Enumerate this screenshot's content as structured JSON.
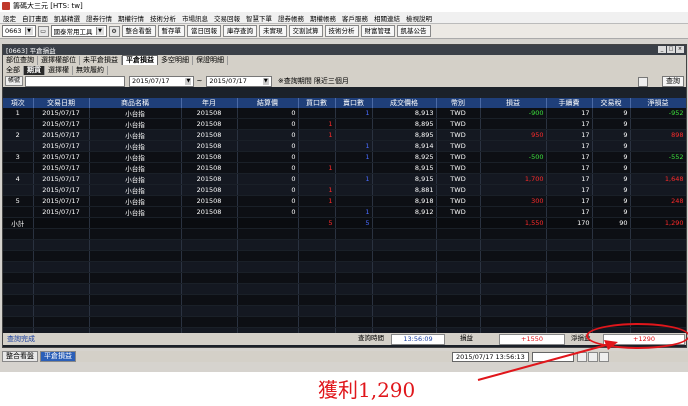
{
  "window_title": "籌碼大三元 [HTS: tw]",
  "menu": [
    "設定",
    "自訂畫面",
    "凱基精選",
    "證券行情",
    "期權行情",
    "技術分析",
    "市場訊息",
    "交易回報",
    "智慧下單",
    "證券帳務",
    "期權帳務",
    "客戶服務",
    "相關連結",
    "檢視說明"
  ],
  "toolbar": {
    "code": "0663",
    "code_dd": "▼",
    "tools_combo": "國泰常用工具",
    "tools_dd": "▼",
    "gear": "⚙",
    "print": "▭",
    "buttons": [
      "整合看盤",
      "暫存單",
      "當日回報",
      "庫存查詢",
      "未實現",
      "交割試算",
      "技術分析",
      "財富管理",
      "凱基公告"
    ]
  },
  "inner_window": {
    "title": "[0663] 平倉損益",
    "controls": [
      "_",
      "□",
      "×"
    ],
    "tabs": [
      "部位查詢",
      "選擇權部位",
      "未平倉損益",
      "平倉損益",
      "多空明細",
      "保證明細"
    ],
    "active_tab": "平倉損益",
    "subtabs": [
      "全部",
      "期貨",
      "選擇權",
      "無效履約"
    ],
    "active_subtab": "期貨"
  },
  "filter": {
    "account_label": "帳號",
    "date_from": "2015/07/17",
    "date_to": "2015/07/17",
    "date_dd": "▼",
    "separator": "~",
    "note": "※查詢期間 限近三個月",
    "query_button": "查詢",
    "refresh_icon": "↻"
  },
  "table": {
    "columns": [
      "項次",
      "交易日期",
      "商品名稱",
      "年月",
      "結算價",
      "買口數",
      "賣口數",
      "成交價格",
      "幣別",
      "損益",
      "手續費",
      "交易稅",
      "淨損益"
    ],
    "rows": [
      {
        "idx": "1",
        "date": "2015/07/17",
        "name": "小台指",
        "ym": "201508",
        "settle": "0",
        "buy": "",
        "sell": "1",
        "price": "8,913",
        "cur": "TWD",
        "pl": "-900",
        "fee": "17",
        "tax": "9",
        "net": "-952",
        "pl_cls": "green",
        "net_cls": "green",
        "buy_cls": "",
        "sell_cls": "blue"
      },
      {
        "idx": "",
        "date": "2015/07/17",
        "name": "小台指",
        "ym": "201508",
        "settle": "0",
        "buy": "1",
        "sell": "",
        "price": "8,895",
        "cur": "TWD",
        "pl": "",
        "fee": "17",
        "tax": "9",
        "net": "",
        "pl_cls": "",
        "net_cls": "",
        "buy_cls": "red",
        "sell_cls": ""
      },
      {
        "idx": "2",
        "date": "2015/07/17",
        "name": "小台指",
        "ym": "201508",
        "settle": "0",
        "buy": "1",
        "sell": "",
        "price": "8,895",
        "cur": "TWD",
        "pl": "950",
        "fee": "17",
        "tax": "9",
        "net": "898",
        "pl_cls": "red",
        "net_cls": "red",
        "buy_cls": "red",
        "sell_cls": ""
      },
      {
        "idx": "",
        "date": "2015/07/17",
        "name": "小台指",
        "ym": "201508",
        "settle": "0",
        "buy": "",
        "sell": "1",
        "price": "8,914",
        "cur": "TWD",
        "pl": "",
        "fee": "17",
        "tax": "9",
        "net": "",
        "pl_cls": "",
        "net_cls": "",
        "buy_cls": "",
        "sell_cls": "blue"
      },
      {
        "idx": "3",
        "date": "2015/07/17",
        "name": "小台指",
        "ym": "201508",
        "settle": "0",
        "buy": "",
        "sell": "1",
        "price": "8,925",
        "cur": "TWD",
        "pl": "-500",
        "fee": "17",
        "tax": "9",
        "net": "-552",
        "pl_cls": "green",
        "net_cls": "green",
        "buy_cls": "",
        "sell_cls": "blue"
      },
      {
        "idx": "",
        "date": "2015/07/17",
        "name": "小台指",
        "ym": "201508",
        "settle": "0",
        "buy": "1",
        "sell": "",
        "price": "8,915",
        "cur": "TWD",
        "pl": "",
        "fee": "17",
        "tax": "9",
        "net": "",
        "pl_cls": "",
        "net_cls": "",
        "buy_cls": "red",
        "sell_cls": ""
      },
      {
        "idx": "4",
        "date": "2015/07/17",
        "name": "小台指",
        "ym": "201508",
        "settle": "0",
        "buy": "",
        "sell": "1",
        "price": "8,915",
        "cur": "TWD",
        "pl": "1,700",
        "fee": "17",
        "tax": "9",
        "net": "1,648",
        "pl_cls": "red",
        "net_cls": "red",
        "buy_cls": "",
        "sell_cls": "blue"
      },
      {
        "idx": "",
        "date": "2015/07/17",
        "name": "小台指",
        "ym": "201508",
        "settle": "0",
        "buy": "1",
        "sell": "",
        "price": "8,881",
        "cur": "TWD",
        "pl": "",
        "fee": "17",
        "tax": "9",
        "net": "",
        "pl_cls": "",
        "net_cls": "",
        "buy_cls": "red",
        "sell_cls": ""
      },
      {
        "idx": "5",
        "date": "2015/07/17",
        "name": "小台指",
        "ym": "201508",
        "settle": "0",
        "buy": "1",
        "sell": "",
        "price": "8,918",
        "cur": "TWD",
        "pl": "300",
        "fee": "17",
        "tax": "9",
        "net": "248",
        "pl_cls": "red",
        "net_cls": "red",
        "buy_cls": "red",
        "sell_cls": ""
      },
      {
        "idx": "",
        "date": "2015/07/17",
        "name": "小台指",
        "ym": "201508",
        "settle": "0",
        "buy": "",
        "sell": "1",
        "price": "8,912",
        "cur": "TWD",
        "pl": "",
        "fee": "17",
        "tax": "9",
        "net": "",
        "pl_cls": "",
        "net_cls": "",
        "buy_cls": "",
        "sell_cls": "blue"
      }
    ],
    "subtotal": {
      "label": "小計",
      "buy": "5",
      "sell": "5",
      "pl": "1,550",
      "fee": "170",
      "tax": "90",
      "net": "1,290"
    },
    "empty_rows": 12
  },
  "status": {
    "text": "查詢完成",
    "time_label": "查詢時間",
    "time": "13:56:09",
    "pl_label": "損益",
    "pl": "+1550",
    "net_label": "淨損益",
    "net": "+1290"
  },
  "taskbar": {
    "items": [
      "整合看盤",
      "平倉損益"
    ],
    "active": "平倉損益",
    "datetime": "2015/07/17 13:56:13"
  },
  "annotation": "獲利1,290",
  "colors": {
    "profit": "#ff2a2a",
    "loss": "#3ce03c",
    "header": "#1f3f7a",
    "annotation": "#e0161b"
  }
}
